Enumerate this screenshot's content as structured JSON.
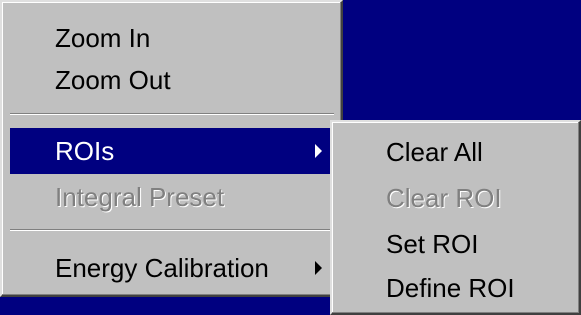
{
  "main_menu": {
    "items": [
      {
        "label": "Zoom In"
      },
      {
        "label": "Zoom Out"
      },
      {
        "label": "ROIs"
      },
      {
        "label": "Integral Preset"
      },
      {
        "label": "Energy Calibration"
      }
    ]
  },
  "rois_submenu": {
    "items": [
      {
        "label": "Clear All"
      },
      {
        "label": "Clear ROI"
      },
      {
        "label": "Set ROI"
      },
      {
        "label": "Define ROI"
      }
    ]
  },
  "colors": {
    "highlight": "#000080",
    "menu_background": "#c0c0c0",
    "disabled_text": "#808080"
  }
}
